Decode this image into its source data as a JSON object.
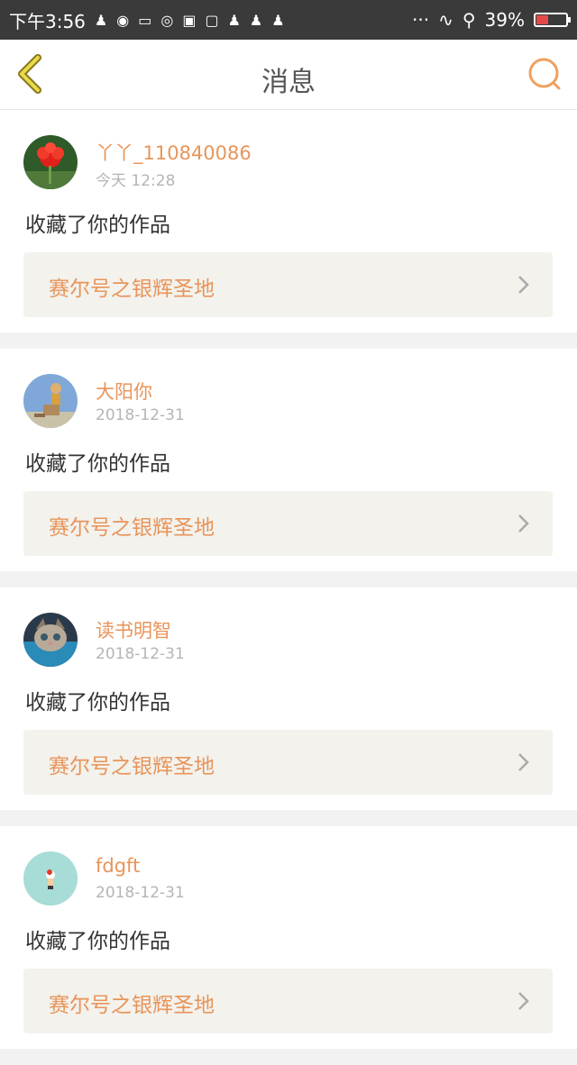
{
  "status_bar": {
    "time": "下午3:56",
    "dots": "···",
    "battery_percent": "39%",
    "battery_level": 0.39,
    "icon_names": [
      "notification-icon",
      "wechat-icon",
      "message-icon",
      "weibo-icon",
      "mi-icon",
      "calendar-icon",
      "signal-icon",
      "bike-icon"
    ]
  },
  "nav": {
    "title": "消息"
  },
  "colors": {
    "accent": "#e8955a",
    "status_bar": "#3a3a3a",
    "card_link_bg": "#f3f2ed"
  },
  "messages": [
    {
      "username": "丫丫_110840086",
      "time": "今天 12:28",
      "action": "收藏了你的作品",
      "work_title": "赛尔号之银辉圣地",
      "avatar": "red-flower-avatar"
    },
    {
      "username": "大阳你",
      "time": "2018-12-31",
      "action": "收藏了你的作品",
      "work_title": "赛尔号之银辉圣地",
      "avatar": "sky-figure-avatar"
    },
    {
      "username": "读书明智",
      "time": "2018-12-31",
      "action": "收藏了你的作品",
      "work_title": "赛尔号之银辉圣地",
      "avatar": "kitten-avatar"
    },
    {
      "username": "fdgft",
      "time": "2018-12-31",
      "action": "收藏了你的作品",
      "work_title": "赛尔号之银辉圣地",
      "avatar": "cartoon-avatar"
    }
  ]
}
